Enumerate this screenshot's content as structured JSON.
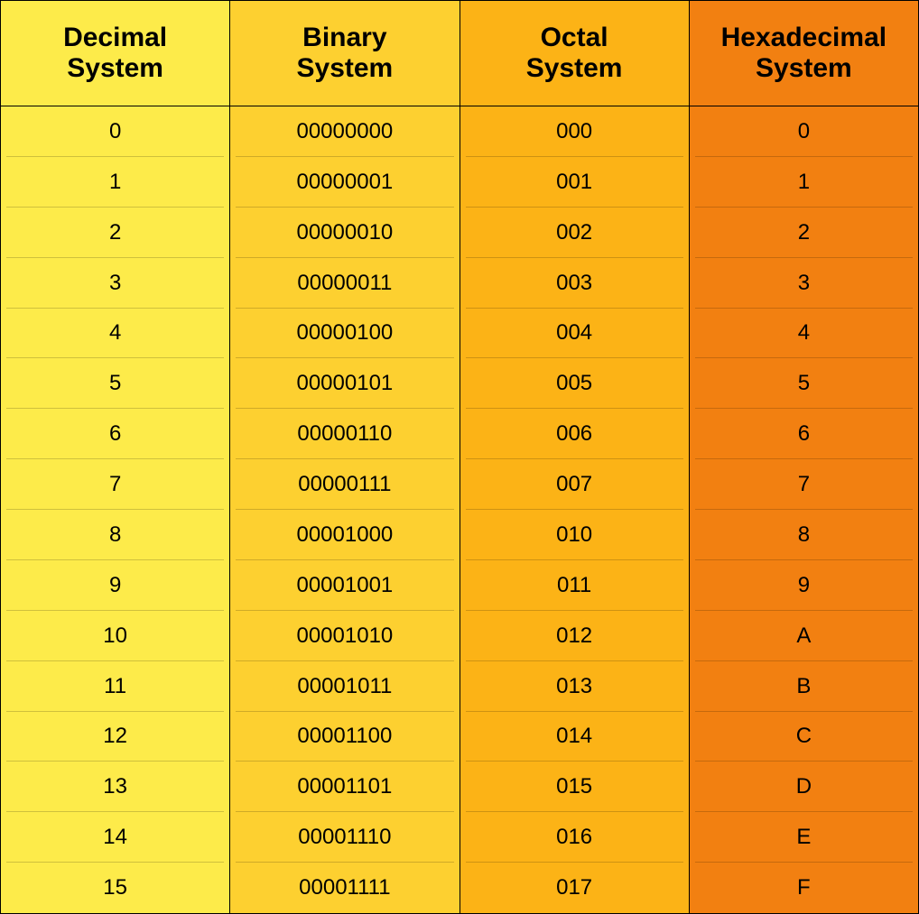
{
  "chart_data": {
    "type": "table",
    "columns": [
      "Decimal System",
      "Binary System",
      "Octal System",
      "Hexadecimal System"
    ],
    "rows": [
      [
        "0",
        "00000000",
        "000",
        "0"
      ],
      [
        "1",
        "00000001",
        "001",
        "1"
      ],
      [
        "2",
        "00000010",
        "002",
        "2"
      ],
      [
        "3",
        "00000011",
        "003",
        "3"
      ],
      [
        "4",
        "00000100",
        "004",
        "4"
      ],
      [
        "5",
        "00000101",
        "005",
        "5"
      ],
      [
        "6",
        "00000110",
        "006",
        "6"
      ],
      [
        "7",
        "00000111",
        "007",
        "7"
      ],
      [
        "8",
        "00001000",
        "010",
        "8"
      ],
      [
        "9",
        "00001001",
        "011",
        "9"
      ],
      [
        "10",
        "00001010",
        "012",
        "A"
      ],
      [
        "11",
        "00001011",
        "013",
        "B"
      ],
      [
        "12",
        "00001100",
        "014",
        "C"
      ],
      [
        "13",
        "00001101",
        "015",
        "D"
      ],
      [
        "14",
        "00001110",
        "016",
        "E"
      ],
      [
        "15",
        "00001111",
        "017",
        "F"
      ]
    ]
  },
  "headers": {
    "0": "Decimal\nSystem",
    "1": "Binary\nSystem",
    "2": "Octal\nSystem",
    "3": "Hexadecimal\nSystem"
  }
}
